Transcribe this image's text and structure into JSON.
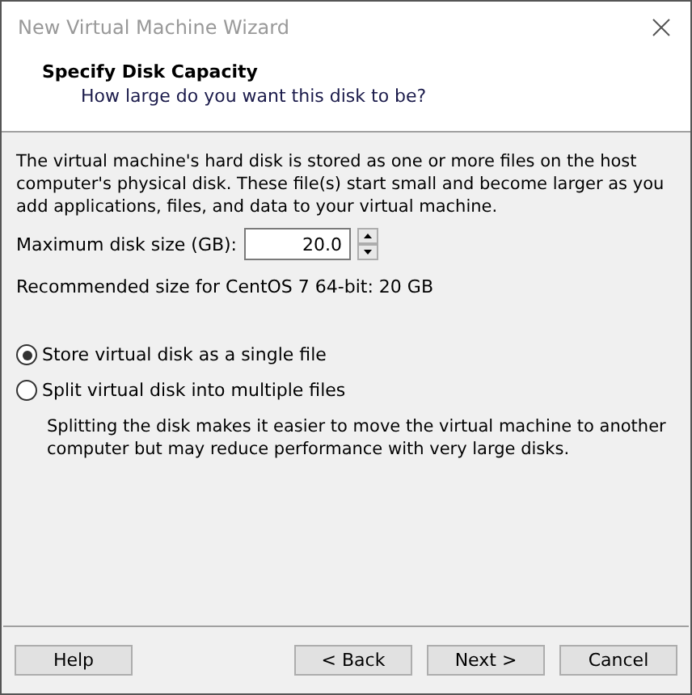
{
  "window": {
    "title": "New Virtual Machine Wizard"
  },
  "header": {
    "title": "Specify Disk Capacity",
    "subtitle": "How large do you want this disk to be?"
  },
  "intro": "The virtual machine's hard disk is stored as one or more files on the host computer's physical disk. These file(s) start small and become larger as you add applications, files, and data to your virtual machine.",
  "disk_size": {
    "label": "Maximum disk size (GB):",
    "value": "20.0"
  },
  "recommended": "Recommended size for CentOS 7 64-bit: 20 GB",
  "options": [
    {
      "label": "Store virtual disk as a single file",
      "selected": true
    },
    {
      "label": "Split virtual disk into multiple files",
      "selected": false,
      "description": "Splitting the disk makes it easier to move the virtual machine to another computer but may reduce performance with very large disks."
    }
  ],
  "buttons": {
    "left": [
      "Help"
    ],
    "right": [
      "< Back",
      "Next >",
      "Cancel"
    ]
  }
}
